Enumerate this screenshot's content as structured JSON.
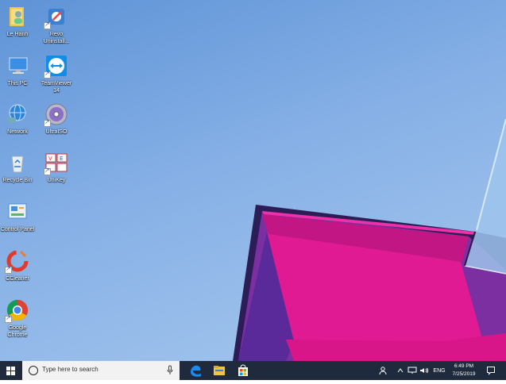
{
  "desktop": {
    "icons": [
      {
        "name": "user-folder",
        "label": "Le Hanh"
      },
      {
        "name": "revo-uninstaller",
        "label": "Revo\nUninstall..."
      },
      {
        "name": "this-pc",
        "label": "This PC"
      },
      {
        "name": "teamviewer",
        "label": "TeamViewer\n14"
      },
      {
        "name": "network",
        "label": "Network"
      },
      {
        "name": "ultraiso",
        "label": "UltraISO"
      },
      {
        "name": "recycle-bin",
        "label": "Recycle Bin"
      },
      {
        "name": "unikey",
        "label": "UniKey"
      },
      {
        "name": "control-panel",
        "label": "Control Panel"
      },
      {
        "name": "ccleaner",
        "label": "CCleaner"
      },
      {
        "name": "google-chrome",
        "label": "Google\nChrome"
      }
    ]
  },
  "taskbar": {
    "search_placeholder": "Type here to search",
    "apps": [
      "windows-start-icon",
      "microsoft-edge-icon",
      "file-explorer-icon",
      "microsoft-store-icon"
    ],
    "tray": {
      "language": "ENG",
      "time": "6:49 PM",
      "date": "7/25/2019"
    }
  },
  "colors": {
    "taskbar": "#1f2b3c",
    "desktop_sky": "#86b0e6",
    "magenta": "#e0158c",
    "purple": "#6a2a8c"
  }
}
